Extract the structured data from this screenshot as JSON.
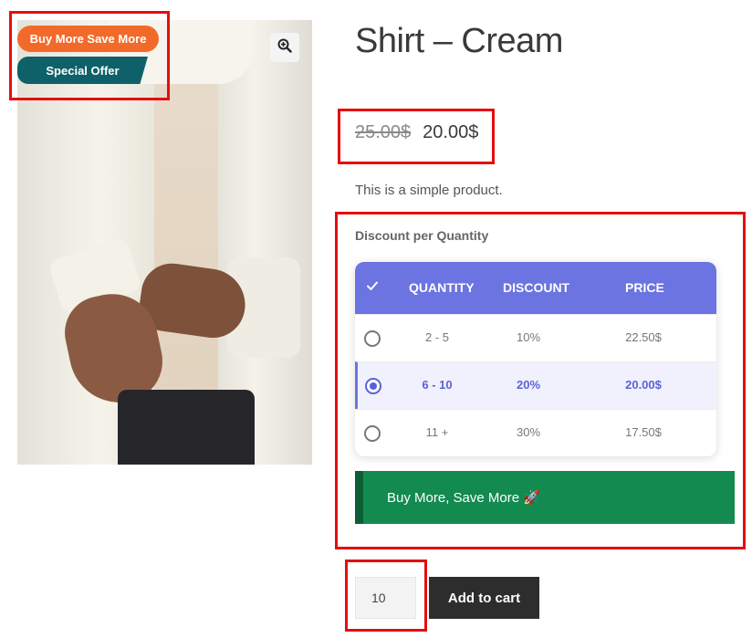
{
  "product": {
    "title": "Shirt – Cream",
    "old_price": "25.00$",
    "new_price": "20.00$",
    "description": "This is a simple product."
  },
  "badges": {
    "primary": "Buy More Save More",
    "secondary": "Special Offer"
  },
  "discount": {
    "heading": "Discount per Quantity",
    "columns": [
      "QUANTITY",
      "DISCOUNT",
      "PRICE"
    ],
    "rows": [
      {
        "quantity": "2 - 5",
        "discount": "10%",
        "price": "22.50$",
        "selected": false
      },
      {
        "quantity": "6 - 10",
        "discount": "20%",
        "price": "20.00$",
        "selected": true
      },
      {
        "quantity": "11 +",
        "discount": "30%",
        "price": "17.50$",
        "selected": false
      }
    ],
    "promo_label": "Buy More, Save More 🚀"
  },
  "cart": {
    "quantity": "10",
    "button_label": "Add to cart"
  },
  "icons": {
    "zoom": "magnifier-plus-icon",
    "header_check": "checkmark-icon"
  },
  "colors": {
    "accent": "#6b74e0",
    "badge_orange": "#f26a2a",
    "badge_teal": "#0e6168",
    "promo_green": "#138a50",
    "highlight_red": "#e50e0e"
  }
}
